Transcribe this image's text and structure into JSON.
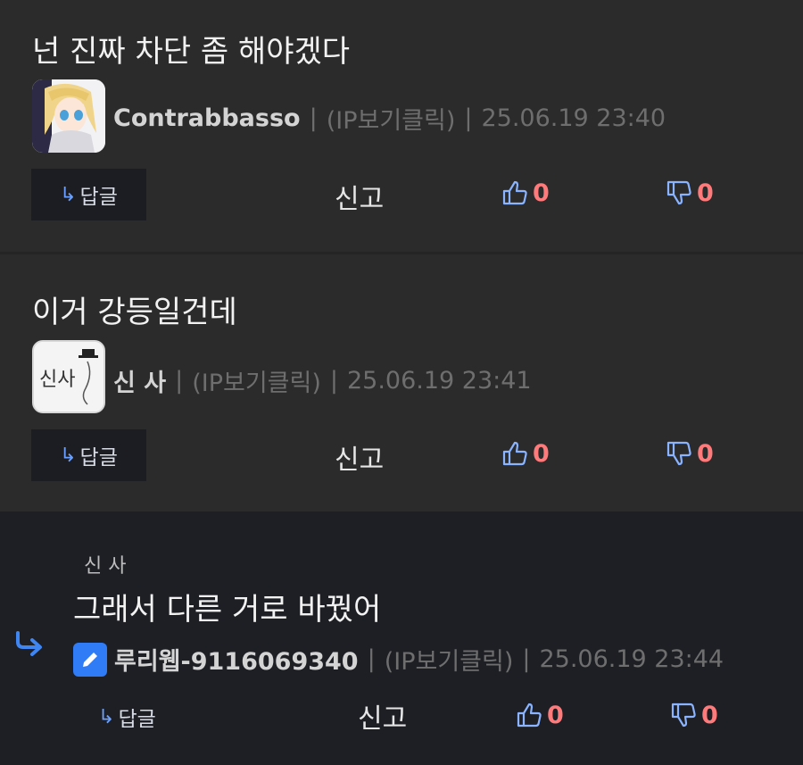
{
  "comments": [
    {
      "text": "넌 진짜 차단 좀 해야겠다",
      "nickname": "Contrabbasso",
      "ip": "(IP보기클릭)",
      "time": "25.06.19 23:40",
      "reply_label": "답글",
      "report_label": "신고",
      "likes": "0",
      "dislikes": "0"
    },
    {
      "text": "이거 강등일건데",
      "nickname": "신 사",
      "avatar_text": "신사",
      "ip": "(IP보기클릭)",
      "time": "25.06.19 23:41",
      "reply_label": "답글",
      "report_label": "신고",
      "likes": "0",
      "dislikes": "0"
    },
    {
      "parent": "신 사",
      "text": "그래서 다른 거로 바꿨어",
      "nickname": "루리웹-9116069340",
      "ip": "(IP보기클릭)",
      "time": "25.06.19 23:44",
      "reply_label": "답글",
      "report_label": "신고",
      "likes": "0",
      "dislikes": "0"
    }
  ],
  "separator": "|",
  "reply_arrow": "↳",
  "icons": {
    "like": "thumbs-up-icon",
    "dislike": "thumbs-down-icon",
    "edit": "pencil-icon",
    "nested": "reply-arrow-icon"
  },
  "colors": {
    "accent_blue": "#6aa0ff",
    "count_red": "#ff7a7a",
    "edit_badge": "#2f7cf6"
  }
}
